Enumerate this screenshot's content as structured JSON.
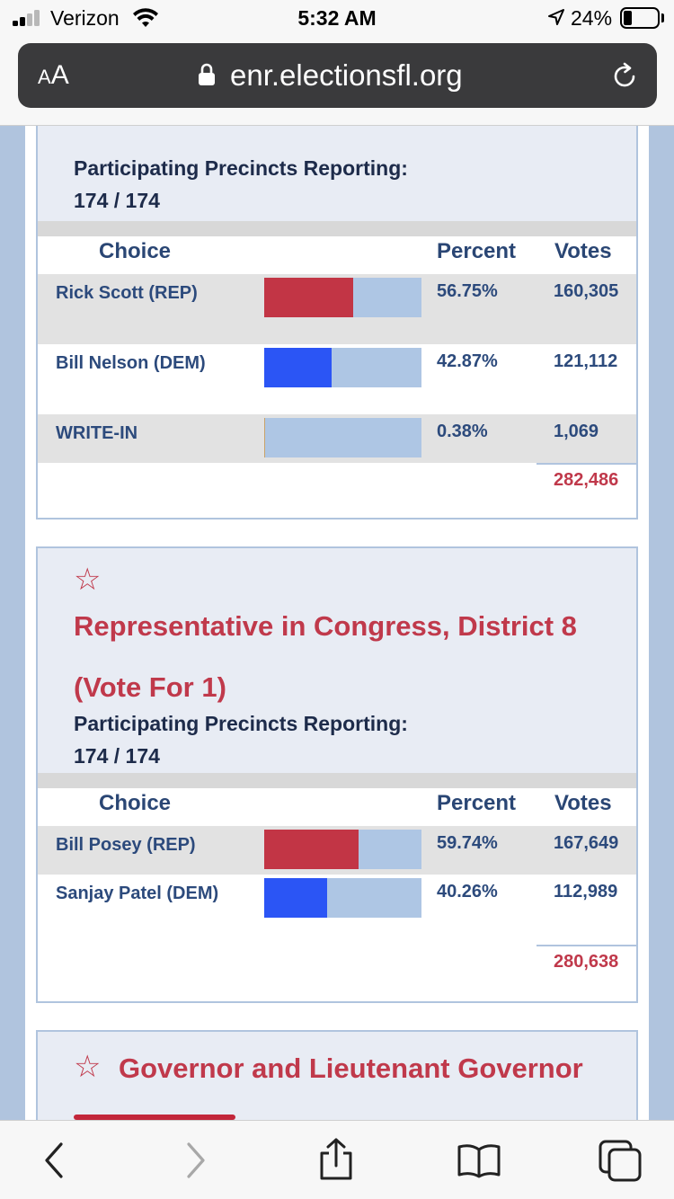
{
  "status_bar": {
    "carrier": "Verizon",
    "time": "5:32 AM",
    "battery_percent": "24%",
    "battery_level": 0.24
  },
  "url_bar": {
    "text_size_label_small": "A",
    "text_size_label_large": "A",
    "url": "enr.electionsfl.org"
  },
  "races": [
    {
      "precincts_label": "Participating Precincts Reporting:",
      "precincts_value": "174 / 174",
      "columns": {
        "choice": "Choice",
        "percent": "Percent",
        "votes": "Votes"
      },
      "candidates": [
        {
          "name": "Rick Scott (REP)",
          "percent": "56.75%",
          "votes": "160,305",
          "share": 0.5675,
          "color": "#c23545"
        },
        {
          "name": "Bill Nelson (DEM)",
          "percent": "42.87%",
          "votes": "121,112",
          "share": 0.4287,
          "color": "#2b55f5"
        },
        {
          "name": "WRITE-IN",
          "percent": "0.38%",
          "votes": "1,069",
          "share": 0.0038,
          "color": "#c9a36a"
        }
      ],
      "total": "282,486"
    },
    {
      "title_line1": "Representative in Congress, District 8",
      "title_line2": "(Vote For 1)",
      "precincts_label": "Participating Precincts Reporting:",
      "precincts_value": "174 / 174",
      "columns": {
        "choice": "Choice",
        "percent": "Percent",
        "votes": "Votes"
      },
      "candidates": [
        {
          "name": "Bill Posey (REP)",
          "percent": "59.74%",
          "votes": "167,649",
          "share": 0.5974,
          "color": "#c23545"
        },
        {
          "name": "Sanjay Patel (DEM)",
          "percent": "40.26%",
          "votes": "112,989",
          "share": 0.4026,
          "color": "#2b55f5"
        }
      ],
      "total": "280,638"
    },
    {
      "title_line1": "Governor and Lieutenant Governor"
    }
  ],
  "icons": {
    "favorite": "star-outline-icon",
    "back": "chevron-left-icon",
    "forward": "chevron-right-icon",
    "share": "share-icon",
    "bookmarks": "book-icon",
    "tabs": "tabs-icon"
  }
}
